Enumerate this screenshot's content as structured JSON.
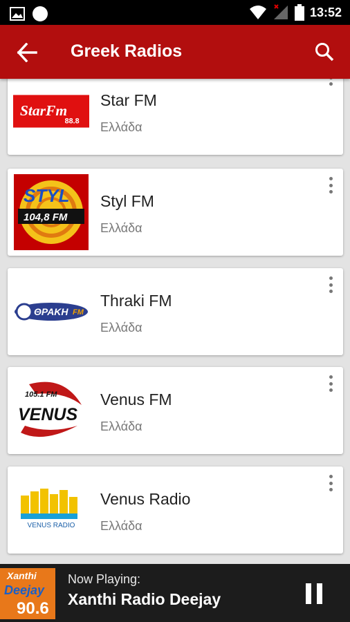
{
  "status_bar": {
    "time": "13:52"
  },
  "app_bar": {
    "title": "Greek Radios"
  },
  "stations": [
    {
      "name": "Star FM",
      "country": "Ελλάδα",
      "logo_text": "StarFm",
      "logo_sub": "88.8"
    },
    {
      "name": "Styl FM",
      "country": "Ελλάδα",
      "logo_text": "STYL",
      "logo_sub": "104,8 FM"
    },
    {
      "name": "Thraki FM",
      "country": "Ελλάδα",
      "logo_text": "ΘΡΑΚΗ",
      "logo_sub": "FM"
    },
    {
      "name": "Venus FM",
      "country": "Ελλάδα",
      "logo_text": "VENUS",
      "logo_sub": "105.1 FM"
    },
    {
      "name": "Venus Radio",
      "country": "Ελλάδα",
      "logo_text": "VENUS RADIO",
      "logo_sub": ""
    }
  ],
  "player": {
    "label": "Now Playing:",
    "station": "Xanthi Radio Deejay",
    "logo_top": "Xanthi",
    "logo_mid": "Deejay",
    "logo_num": "90.6"
  },
  "colors": {
    "primary": "#b20e0e",
    "player_bg": "#1c1c1c",
    "list_bg": "#e3e3e3"
  }
}
